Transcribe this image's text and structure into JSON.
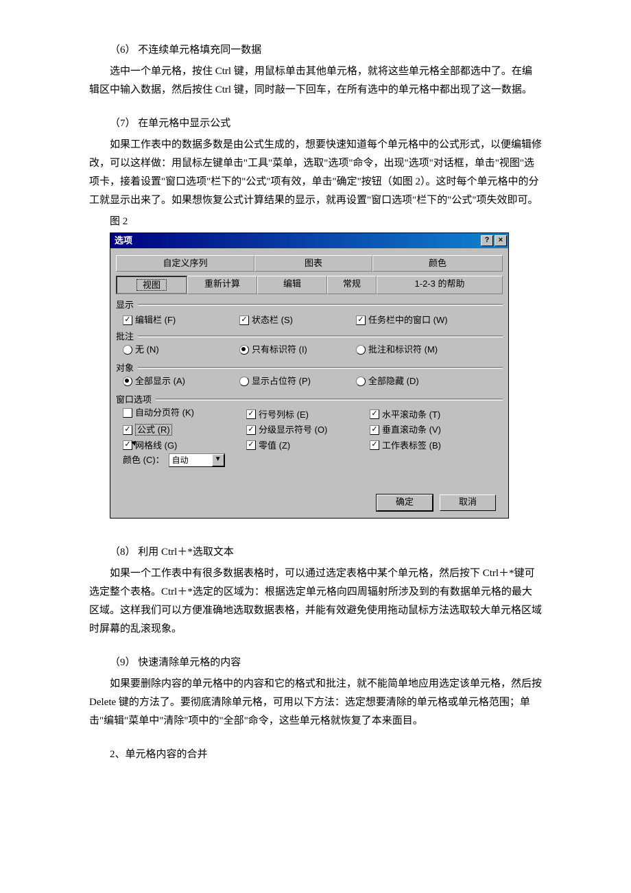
{
  "p6_title": "（6） 不连续单元格填充同一数据",
  "p6_body": "选中一个单元格，按住 Ctrl 键，用鼠标单击其他单元格，就将这些单元格全部都选中了。在编辑区中输入数据，然后按住 Ctrl 键，同时敲一下回车，在所有选中的单元格中都出现了这一数据。",
  "p7_title": "（7） 在单元格中显示公式",
  "p7_body": "如果工作表中的数据多数是由公式生成的，想要快速知道每个单元格中的公式形式，以便编辑修改，可以这样做：用鼠标左键单击\"工具\"菜单，选取\"选项\"命令，出现\"选项\"对话框，单击\"视图\"选项卡，接着设置\"窗口选项\"栏下的\"公式\"项有效，单击\"确定\"按钮（如图 2）。这时每个单元格中的分工就显示出来了。如果想恢复公式计算结果的显示，就再设置\"窗口选项\"栏下的\"公式\"项失效即可。",
  "fig_label": "图 2",
  "dialog": {
    "title": "选项",
    "tabs_top": [
      "自定义序列",
      "图表",
      "颜色"
    ],
    "tabs_bottom": [
      "视图",
      "重新计算",
      "编辑",
      "常规",
      "1-2-3 的帮助"
    ],
    "sec_display": "显示",
    "chk_formula_bar": "编辑栏 (F)",
    "chk_status_bar": "状态栏 (S)",
    "chk_taskbar_win": "任务栏中的窗口 (W)",
    "sec_comments": "批注",
    "rdo_none": "无 (N)",
    "rdo_indicator": "只有标识符 (I)",
    "rdo_comment_ind": "批注和标识符 (M)",
    "sec_objects": "对象",
    "rdo_show_all": "全部显示 (A)",
    "rdo_placeholders": "显示占位符 (P)",
    "rdo_hide_all": "全部隐藏 (D)",
    "sec_window": "窗口选项",
    "chk_page_breaks": "自动分页符 (K)",
    "chk_formulas": "公式 (R)",
    "chk_gridlines": "网格线 (G)",
    "lbl_color": "颜色 (C)：",
    "dd_value": "自动",
    "chk_row_col": "行号列标 (E)",
    "chk_outline": "分级显示符号 (O)",
    "chk_zero": "零值 (Z)",
    "chk_hscroll": "水平滚动条 (T)",
    "chk_vscroll": "垂直滚动条 (V)",
    "chk_sheet_tabs": "工作表标签 (B)",
    "btn_ok": "确定",
    "btn_cancel": "取消"
  },
  "p8_title": "（8） 利用 Ctrl＋*选取文本",
  "p8_body": "如果一个工作表中有很多数据表格时，可以通过选定表格中某个单元格，然后按下 Ctrl＋*键可选定整个表格。Ctrl＋*选定的区域为：根据选定单元格向四周辐射所涉及到的有数据单元格的最大区域。这样我们可以方便准确地选取数据表格，并能有效避免使用拖动鼠标方法选取较大单元格区域时屏幕的乱滚现象。",
  "p9_title": "（9） 快速清除单元格的内容",
  "p9_body": "如果要删除内容的单元格中的内容和它的格式和批注，就不能简单地应用选定该单元格，然后按 Delete 键的方法了。要彻底清除单元格，可用以下方法：选定想要清除的单元格或单元格范围；单击\"编辑\"菜单中\"清除\"项中的\"全部\"命令，这些单元格就恢复了本来面目。",
  "p_sec2": "2、单元格内容的合并"
}
